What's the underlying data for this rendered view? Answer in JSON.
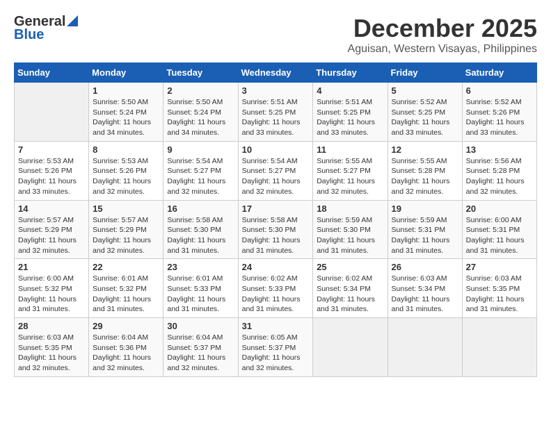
{
  "header": {
    "logo_general": "General",
    "logo_blue": "Blue",
    "month_year": "December 2025",
    "location": "Aguisan, Western Visayas, Philippines"
  },
  "days_of_week": [
    "Sunday",
    "Monday",
    "Tuesday",
    "Wednesday",
    "Thursday",
    "Friday",
    "Saturday"
  ],
  "weeks": [
    [
      {
        "day": "",
        "info": ""
      },
      {
        "day": "1",
        "info": "Sunrise: 5:50 AM\nSunset: 5:24 PM\nDaylight: 11 hours\nand 34 minutes."
      },
      {
        "day": "2",
        "info": "Sunrise: 5:50 AM\nSunset: 5:24 PM\nDaylight: 11 hours\nand 34 minutes."
      },
      {
        "day": "3",
        "info": "Sunrise: 5:51 AM\nSunset: 5:25 PM\nDaylight: 11 hours\nand 33 minutes."
      },
      {
        "day": "4",
        "info": "Sunrise: 5:51 AM\nSunset: 5:25 PM\nDaylight: 11 hours\nand 33 minutes."
      },
      {
        "day": "5",
        "info": "Sunrise: 5:52 AM\nSunset: 5:25 PM\nDaylight: 11 hours\nand 33 minutes."
      },
      {
        "day": "6",
        "info": "Sunrise: 5:52 AM\nSunset: 5:26 PM\nDaylight: 11 hours\nand 33 minutes."
      }
    ],
    [
      {
        "day": "7",
        "info": "Sunrise: 5:53 AM\nSunset: 5:26 PM\nDaylight: 11 hours\nand 33 minutes."
      },
      {
        "day": "8",
        "info": "Sunrise: 5:53 AM\nSunset: 5:26 PM\nDaylight: 11 hours\nand 32 minutes."
      },
      {
        "day": "9",
        "info": "Sunrise: 5:54 AM\nSunset: 5:27 PM\nDaylight: 11 hours\nand 32 minutes."
      },
      {
        "day": "10",
        "info": "Sunrise: 5:54 AM\nSunset: 5:27 PM\nDaylight: 11 hours\nand 32 minutes."
      },
      {
        "day": "11",
        "info": "Sunrise: 5:55 AM\nSunset: 5:27 PM\nDaylight: 11 hours\nand 32 minutes."
      },
      {
        "day": "12",
        "info": "Sunrise: 5:55 AM\nSunset: 5:28 PM\nDaylight: 11 hours\nand 32 minutes."
      },
      {
        "day": "13",
        "info": "Sunrise: 5:56 AM\nSunset: 5:28 PM\nDaylight: 11 hours\nand 32 minutes."
      }
    ],
    [
      {
        "day": "14",
        "info": "Sunrise: 5:57 AM\nSunset: 5:29 PM\nDaylight: 11 hours\nand 32 minutes."
      },
      {
        "day": "15",
        "info": "Sunrise: 5:57 AM\nSunset: 5:29 PM\nDaylight: 11 hours\nand 32 minutes."
      },
      {
        "day": "16",
        "info": "Sunrise: 5:58 AM\nSunset: 5:30 PM\nDaylight: 11 hours\nand 31 minutes."
      },
      {
        "day": "17",
        "info": "Sunrise: 5:58 AM\nSunset: 5:30 PM\nDaylight: 11 hours\nand 31 minutes."
      },
      {
        "day": "18",
        "info": "Sunrise: 5:59 AM\nSunset: 5:30 PM\nDaylight: 11 hours\nand 31 minutes."
      },
      {
        "day": "19",
        "info": "Sunrise: 5:59 AM\nSunset: 5:31 PM\nDaylight: 11 hours\nand 31 minutes."
      },
      {
        "day": "20",
        "info": "Sunrise: 6:00 AM\nSunset: 5:31 PM\nDaylight: 11 hours\nand 31 minutes."
      }
    ],
    [
      {
        "day": "21",
        "info": "Sunrise: 6:00 AM\nSunset: 5:32 PM\nDaylight: 11 hours\nand 31 minutes."
      },
      {
        "day": "22",
        "info": "Sunrise: 6:01 AM\nSunset: 5:32 PM\nDaylight: 11 hours\nand 31 minutes."
      },
      {
        "day": "23",
        "info": "Sunrise: 6:01 AM\nSunset: 5:33 PM\nDaylight: 11 hours\nand 31 minutes."
      },
      {
        "day": "24",
        "info": "Sunrise: 6:02 AM\nSunset: 5:33 PM\nDaylight: 11 hours\nand 31 minutes."
      },
      {
        "day": "25",
        "info": "Sunrise: 6:02 AM\nSunset: 5:34 PM\nDaylight: 11 hours\nand 31 minutes."
      },
      {
        "day": "26",
        "info": "Sunrise: 6:03 AM\nSunset: 5:34 PM\nDaylight: 11 hours\nand 31 minutes."
      },
      {
        "day": "27",
        "info": "Sunrise: 6:03 AM\nSunset: 5:35 PM\nDaylight: 11 hours\nand 31 minutes."
      }
    ],
    [
      {
        "day": "28",
        "info": "Sunrise: 6:03 AM\nSunset: 5:35 PM\nDaylight: 11 hours\nand 32 minutes."
      },
      {
        "day": "29",
        "info": "Sunrise: 6:04 AM\nSunset: 5:36 PM\nDaylight: 11 hours\nand 32 minutes."
      },
      {
        "day": "30",
        "info": "Sunrise: 6:04 AM\nSunset: 5:37 PM\nDaylight: 11 hours\nand 32 minutes."
      },
      {
        "day": "31",
        "info": "Sunrise: 6:05 AM\nSunset: 5:37 PM\nDaylight: 11 hours\nand 32 minutes."
      },
      {
        "day": "",
        "info": ""
      },
      {
        "day": "",
        "info": ""
      },
      {
        "day": "",
        "info": ""
      }
    ]
  ]
}
